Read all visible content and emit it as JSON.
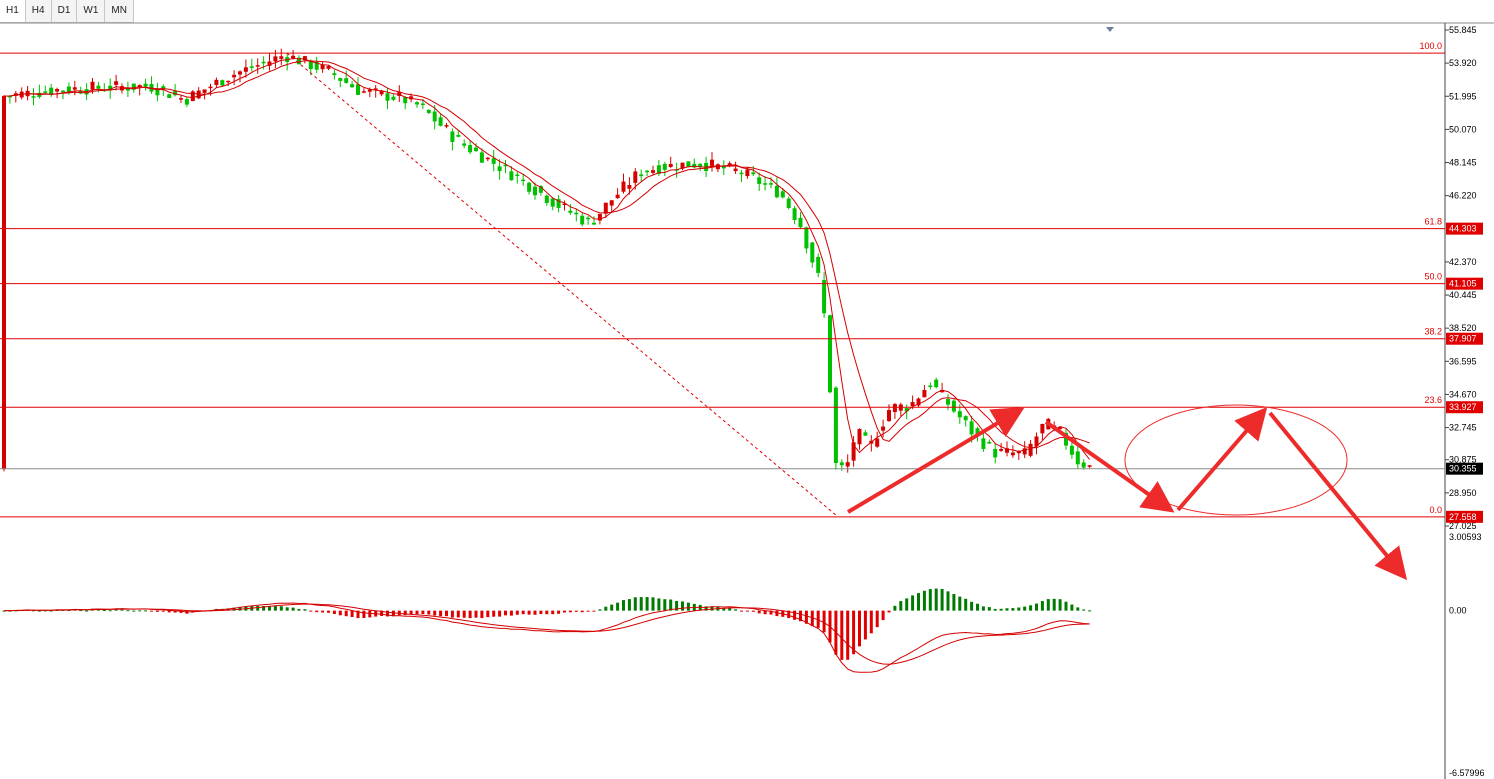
{
  "timeframes": [
    "H1",
    "H4",
    "D1",
    "W1",
    "MN"
  ],
  "active_timeframe": "H1",
  "chart_data": {
    "type": "candlestick",
    "price_axis_ticks": [
      "55.845",
      "53.920",
      "51.995",
      "50.070",
      "48.145",
      "46.220",
      "44.303",
      "42.370",
      "41.105",
      "40.445",
      "38.520",
      "37.907",
      "36.595",
      "34.670",
      "33.927",
      "32.745",
      "30.875",
      "30.355",
      "28.950",
      "27.558",
      "27.025"
    ],
    "price_ylim": [
      27.025,
      55.845
    ],
    "current_price": "30.355",
    "fibonacci": [
      {
        "level": "100.0",
        "price": "54.50"
      },
      {
        "level": "61.8",
        "price": "44.303"
      },
      {
        "level": "50.0",
        "price": "41.105"
      },
      {
        "level": "38.2",
        "price": "37.907"
      },
      {
        "level": "23.6",
        "price": "33.927"
      },
      {
        "level": "0.0",
        "price": "27.558"
      }
    ],
    "indicator": {
      "name": "MACD",
      "axis_labels": [
        "3.00593",
        "0.00",
        "-6.57996"
      ],
      "ylim": [
        -6.57996,
        3.00593
      ]
    }
  }
}
